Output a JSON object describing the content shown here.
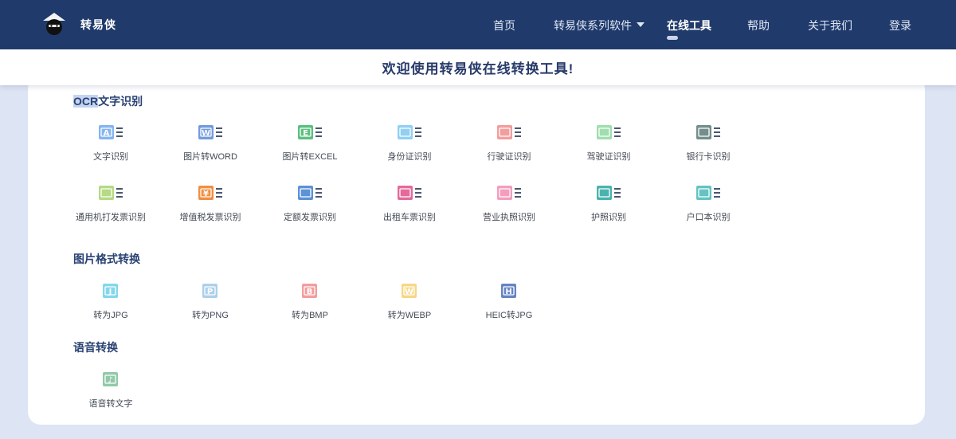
{
  "header": {
    "brand": "转易侠",
    "nav": [
      {
        "label": "首页"
      },
      {
        "label": "转易侠系列软件"
      },
      {
        "label": "在线工具"
      },
      {
        "label": "帮助"
      },
      {
        "label": "关于我们"
      },
      {
        "label": "登录"
      }
    ],
    "active_nav": "在线工具"
  },
  "welcome": "欢迎使用转易侠在线转换工具!",
  "sections": [
    {
      "title_hl": "OCR",
      "title_rest": "文字识别",
      "tools": [
        {
          "label": "文字识别",
          "icon": "text-ocr-icon",
          "color": "#6fa8f0",
          "glyph": "A"
        },
        {
          "label": "图片转WORD",
          "icon": "image-to-word-icon",
          "color": "#5b8ad8",
          "glyph": "W"
        },
        {
          "label": "图片转EXCEL",
          "icon": "image-to-excel-icon",
          "color": "#3fb56a",
          "glyph": "E"
        },
        {
          "label": "身份证识别",
          "icon": "id-card-icon",
          "color": "#7ec8f0",
          "glyph": ""
        },
        {
          "label": "行驶证识别",
          "icon": "driving-license-icon",
          "color": "#f28c8c",
          "glyph": ""
        },
        {
          "label": "驾驶证识别",
          "icon": "driver-license-icon",
          "color": "#8fd8a0",
          "glyph": ""
        },
        {
          "label": "银行卡识别",
          "icon": "bank-card-icon",
          "color": "#5c7a78",
          "glyph": ""
        },
        {
          "label": "通用机打发票识别",
          "icon": "general-invoice-icon",
          "color": "#a8d46e",
          "glyph": ""
        },
        {
          "label": "增值税发票识别",
          "icon": "vat-invoice-icon",
          "color": "#f07a1e",
          "glyph": "¥"
        },
        {
          "label": "定额发票识别",
          "icon": "fixed-invoice-icon",
          "color": "#3f7fd0",
          "glyph": ""
        },
        {
          "label": "出租车票识别",
          "icon": "taxi-receipt-icon",
          "color": "#e0508a",
          "glyph": ""
        },
        {
          "label": "营业执照识别",
          "icon": "business-license-icon",
          "color": "#f28cb0",
          "glyph": ""
        },
        {
          "label": "护照识别",
          "icon": "passport-icon",
          "color": "#2aa6a0",
          "glyph": ""
        },
        {
          "label": "户口本识别",
          "icon": "household-register-icon",
          "color": "#4ab8b8",
          "glyph": ""
        }
      ]
    },
    {
      "title_hl": "",
      "title_rest": "图片格式转换",
      "tools": [
        {
          "label": "转为JPG",
          "icon": "to-jpg-icon",
          "color": "#6fd0e8",
          "glyph": "J"
        },
        {
          "label": "转为PNG",
          "icon": "to-png-icon",
          "color": "#9cc8e8",
          "glyph": "P"
        },
        {
          "label": "转为BMP",
          "icon": "to-bmp-icon",
          "color": "#f28c8c",
          "glyph": "B"
        },
        {
          "label": "转为WEBP",
          "icon": "to-webp-icon",
          "color": "#f5d070",
          "glyph": "W"
        },
        {
          "label": "HEIC转JPG",
          "icon": "heic-to-jpg-icon",
          "color": "#4a6fb8",
          "glyph": "H"
        }
      ]
    },
    {
      "title_hl": "",
      "title_rest": "语音转换",
      "tools": [
        {
          "label": "语音转文字",
          "icon": "speech-to-text-icon",
          "color": "#7fbf9a",
          "glyph": "♪"
        }
      ]
    }
  ]
}
